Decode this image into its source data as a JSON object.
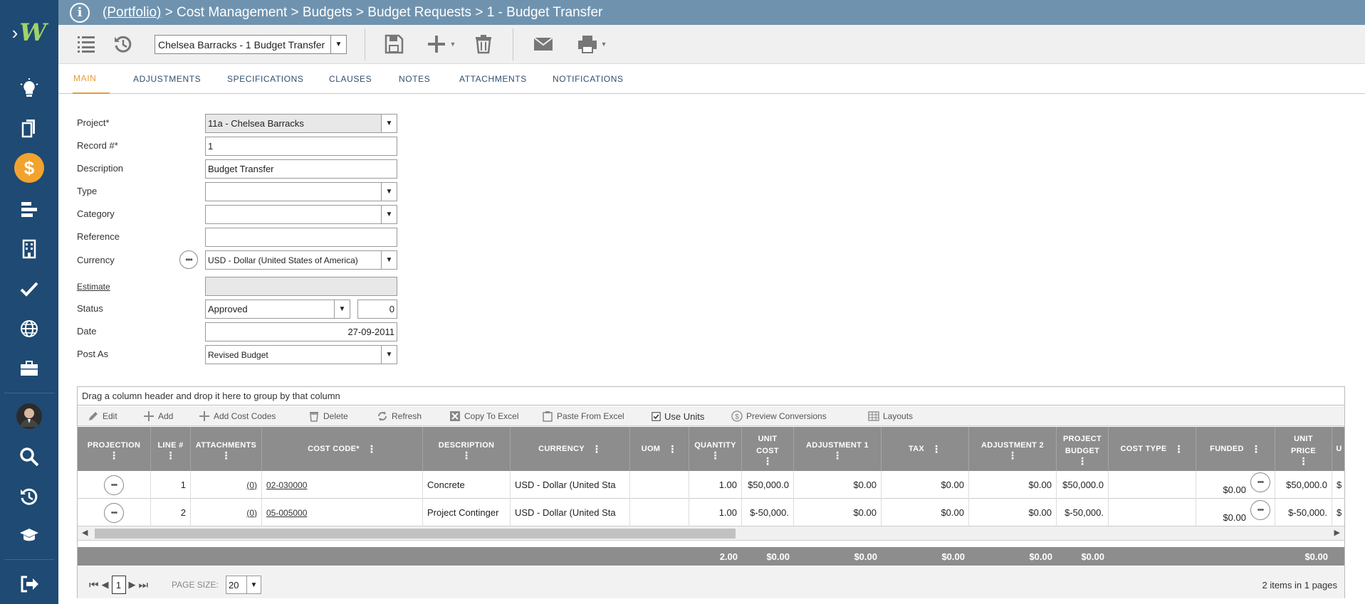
{
  "breadcrumb": {
    "portfolio": "(Portfolio)",
    "rest": " > Cost Management > Budgets > Budget Requests > 1 - Budget Transfer"
  },
  "toolbar": {
    "record_select": "Chelsea Barracks - 1 Budget Transfer"
  },
  "tabs": [
    "MAIN",
    "ADJUSTMENTS",
    "SPECIFICATIONS",
    "CLAUSES",
    "NOTES",
    "ATTACHMENTS",
    "NOTIFICATIONS"
  ],
  "form": {
    "project_label": "Project*",
    "project_value": "11a - Chelsea Barracks",
    "record_label": "Record #*",
    "record_value": "1",
    "description_label": "Description",
    "description_value": "Budget Transfer",
    "type_label": "Type",
    "type_value": "",
    "category_label": "Category",
    "category_value": "",
    "reference_label": "Reference",
    "reference_value": "",
    "currency_label": "Currency",
    "currency_value": "USD - Dollar (United States of America)",
    "estimate_label": "Estimate",
    "estimate_value": "",
    "status_label": "Status",
    "status_value": "Approved",
    "status_number": "0",
    "date_label": "Date",
    "date_value": "27-09-2011",
    "postas_label": "Post As",
    "postas_value": "Revised Budget"
  },
  "grid": {
    "group_hint": "Drag a column header and drop it here to group by that column",
    "toolbar": {
      "edit": "Edit",
      "add": "Add",
      "add_cost_codes": "Add Cost Codes",
      "delete": "Delete",
      "refresh": "Refresh",
      "copy_excel": "Copy To Excel",
      "paste_excel": "Paste From Excel",
      "use_units": "Use Units",
      "preview_conversions": "Preview Conversions",
      "layouts": "Layouts"
    },
    "headers": {
      "projection": "PROJECTION",
      "line": "LINE #",
      "attachments": "ATTACHMENTS",
      "cost_code": "COST CODE*",
      "description": "DESCRIPTION",
      "currency": "CURRENCY",
      "uom": "UOM",
      "quantity": "QUANTITY",
      "unit_cost_1": "UNIT",
      "unit_cost_2": "COST",
      "adjustment1": "ADJUSTMENT 1",
      "tax": "TAX",
      "adjustment2": "ADJUSTMENT 2",
      "project_budget_1": "PROJECT",
      "project_budget_2": "BUDGET",
      "cost_type": "COST TYPE",
      "funded": "FUNDED",
      "unit_price_1": "UNIT",
      "unit_price_2": "PRICE",
      "extra": "U"
    },
    "rows": [
      {
        "line": "1",
        "attachments": "(0)",
        "cost_code": "02-030000",
        "description": "Concrete",
        "currency": "USD - Dollar (United Sta",
        "uom": "",
        "quantity": "1.00",
        "unit_cost": "$50,000.0",
        "adjustment1": "$0.00",
        "tax": "$0.00",
        "adjustment2": "$0.00",
        "project_budget": "$50,000.0",
        "cost_type": "",
        "funded": "$0.00",
        "unit_price": "$50,000.0",
        "extra": "$"
      },
      {
        "line": "2",
        "attachments": "(0)",
        "cost_code": "05-005000",
        "description": "Project Continger",
        "currency": "USD - Dollar (United Sta",
        "uom": "",
        "quantity": "1.00",
        "unit_cost": "$-50,000.",
        "adjustment1": "$0.00",
        "tax": "$0.00",
        "adjustment2": "$0.00",
        "project_budget": "$-50,000.",
        "cost_type": "",
        "funded": "$0.00",
        "unit_price": "$-50,000.",
        "extra": "$"
      }
    ],
    "totals": {
      "quantity": "2.00",
      "unit_cost": "$0.00",
      "adjustment1": "$0.00",
      "tax": "$0.00",
      "adjustment2": "$0.00",
      "project_budget": "$0.00",
      "unit_price": "$0.00"
    },
    "pager": {
      "page": "1",
      "page_size_label": "PAGE SIZE:",
      "page_size": "20",
      "summary": "2 items in 1 pages"
    }
  },
  "colors": {
    "sidebar": "#1e4a73",
    "header": "#6f93af",
    "accent": "#e89a3c",
    "grid_header": "#8d8d8d"
  }
}
